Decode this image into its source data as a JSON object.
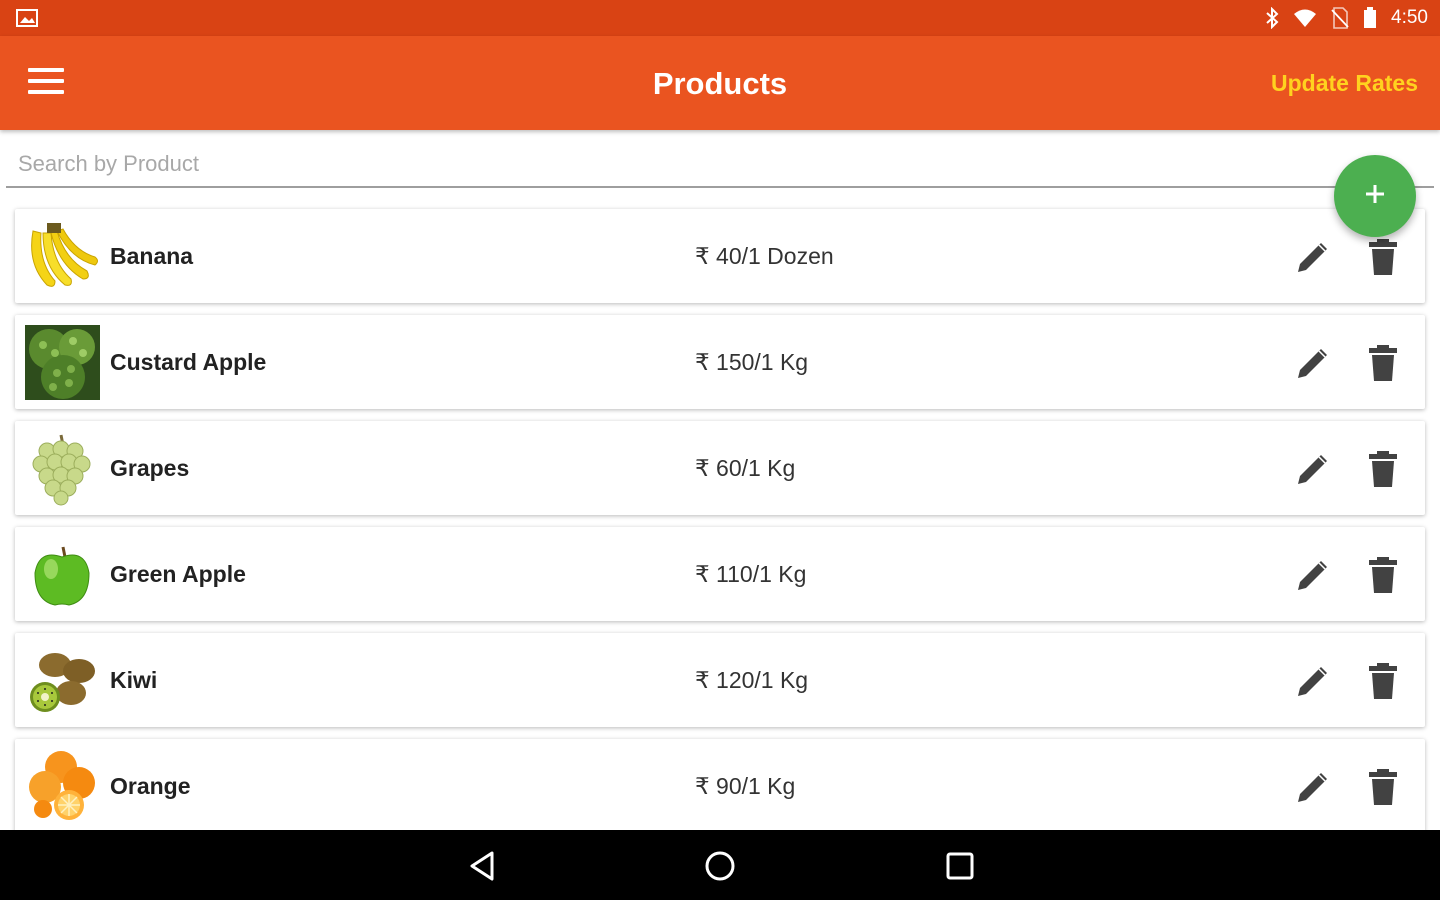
{
  "status_bar": {
    "time": "4:50",
    "icons": [
      "image-icon",
      "bluetooth-icon",
      "wifi-icon",
      "no-sim-icon",
      "battery-icon"
    ]
  },
  "app_bar": {
    "menu_icon": "hamburger-menu-icon",
    "title": "Products",
    "action_label": "Update Rates",
    "background": "#EA5420",
    "action_color": "#FFD21F"
  },
  "search": {
    "placeholder": "Search by Product",
    "value": ""
  },
  "fab": {
    "icon": "plus-icon",
    "color": "#4CAF50"
  },
  "products": [
    {
      "name": "Banana",
      "price": "₹ 40/1 Dozen",
      "image": "banana-image"
    },
    {
      "name": "Custard Apple",
      "price": "₹ 150/1 Kg",
      "image": "custard-apple-image"
    },
    {
      "name": "Grapes",
      "price": "₹ 60/1 Kg",
      "image": "grapes-image"
    },
    {
      "name": "Green Apple",
      "price": "₹ 110/1 Kg",
      "image": "green-apple-image"
    },
    {
      "name": "Kiwi",
      "price": "₹ 120/1 Kg",
      "image": "kiwi-image"
    },
    {
      "name": "Orange",
      "price": "₹ 90/1 Kg",
      "image": "orange-image"
    }
  ],
  "row_actions": {
    "edit_icon": "pencil-icon",
    "delete_icon": "trash-icon"
  },
  "nav_bar": {
    "buttons": [
      "back-icon",
      "home-icon",
      "recents-icon"
    ]
  }
}
